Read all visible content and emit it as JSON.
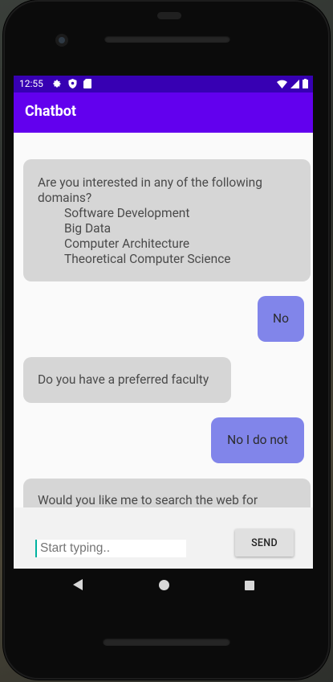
{
  "status": {
    "time": "12:55"
  },
  "appbar": {
    "title": "Chatbot"
  },
  "messages": [
    {
      "from": "bot",
      "text": "Are you interested in any of the following domains?",
      "items": [
        "Software Development",
        "Big Data",
        "Computer Architecture",
        "Theoretical Computer Science"
      ]
    },
    {
      "from": "user",
      "text": "No"
    },
    {
      "from": "bot",
      "text": "Do you have a preferred faculty"
    },
    {
      "from": "user",
      "text": "No I do not"
    },
    {
      "from": "bot",
      "text": "Would you like me to search the web for"
    }
  ],
  "input": {
    "placeholder": "Start typing.."
  },
  "send": {
    "label": "SEND"
  },
  "colors": {
    "statusbar": "#3700b3",
    "appbar": "#6200ee",
    "bot_bubble": "#d6d6d6",
    "user_bubble": "#8185ea"
  },
  "icons": {
    "status_left": [
      "gear-icon",
      "shield-icon",
      "sd-card-icon"
    ],
    "status_right": [
      "wifi-icon",
      "signal-icon",
      "battery-icon"
    ]
  }
}
